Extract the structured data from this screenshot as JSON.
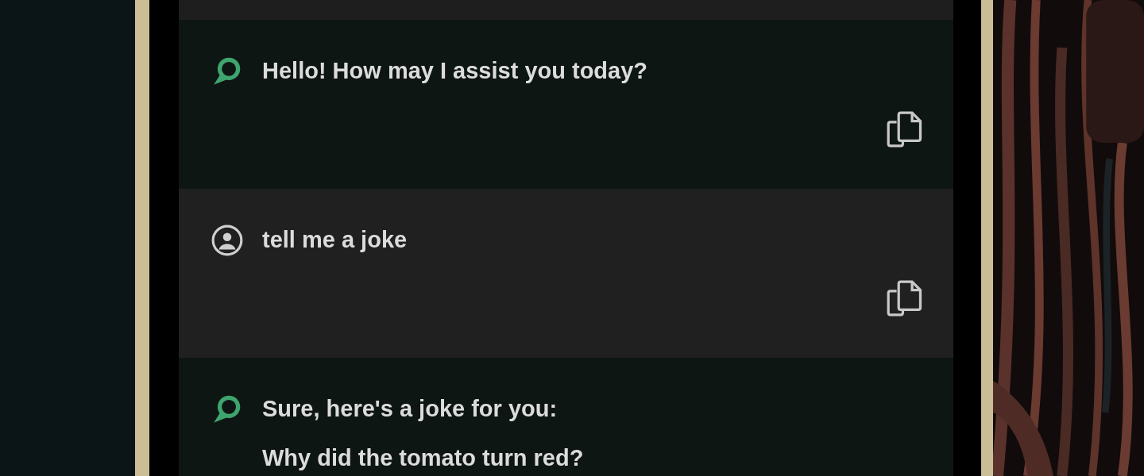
{
  "messages": [
    {
      "kind": "partial"
    },
    {
      "kind": "bot",
      "paragraphs": [
        "Hello! How may I assist you today?"
      ],
      "copy_button": true
    },
    {
      "kind": "user",
      "paragraphs": [
        "tell me a joke"
      ],
      "copy_button": true
    },
    {
      "kind": "bot",
      "paragraphs": [
        "Sure, here's a joke for you:",
        "Why did the tomato turn red?"
      ],
      "copy_button": false
    }
  ]
}
